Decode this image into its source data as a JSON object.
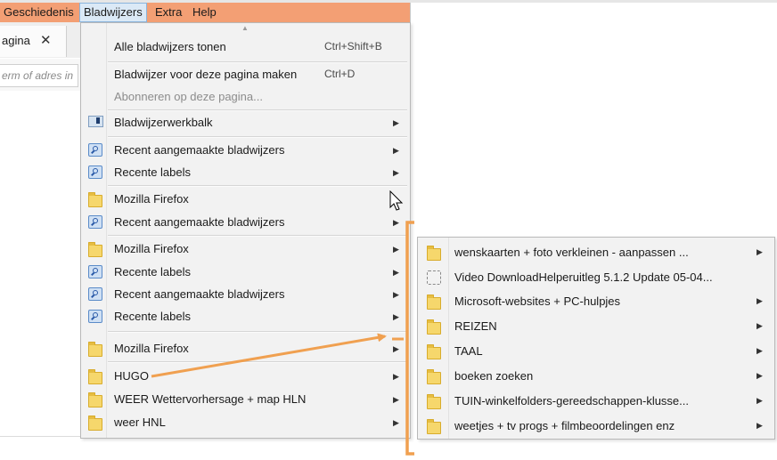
{
  "menubar": {
    "items": [
      {
        "label": "Geschiedenis",
        "active": false
      },
      {
        "label": "Bladwijzers",
        "active": true
      },
      {
        "label": "Extra",
        "active": false
      },
      {
        "label": "Help",
        "active": false
      }
    ]
  },
  "tab": {
    "label": "agina"
  },
  "urlbar": {
    "placeholder": "erm of adres in"
  },
  "bookmarks_menu": {
    "items": [
      {
        "label": "Alle bladwijzers tonen",
        "shortcut": "Ctrl+Shift+B",
        "icon": "none"
      },
      {
        "label": "Bladwijzer voor deze pagina maken",
        "shortcut": "Ctrl+D",
        "icon": "none"
      },
      {
        "label": "Abonneren op deze pagina...",
        "icon": "none",
        "disabled": true
      },
      {
        "label": "Bladwijzerwerkbalk",
        "icon": "toolbar-icon",
        "submenu": true
      },
      {
        "label": "Recent aangemaakte bladwijzers",
        "icon": "search-folder-icon",
        "submenu": true
      },
      {
        "label": "Recente labels",
        "icon": "search-folder-icon",
        "submenu": true
      },
      {
        "label": "Mozilla Firefox",
        "icon": "folder-icon",
        "submenu": false
      },
      {
        "label": "Recent aangemaakte bladwijzers",
        "icon": "search-folder-icon",
        "submenu": true
      },
      {
        "label": "Mozilla Firefox",
        "icon": "folder-icon",
        "submenu": true
      },
      {
        "label": "Recente labels",
        "icon": "search-folder-icon",
        "submenu": true
      },
      {
        "label": "Recent aangemaakte bladwijzers",
        "icon": "search-folder-icon",
        "submenu": true
      },
      {
        "label": "Recente labels",
        "icon": "search-folder-icon",
        "submenu": true
      },
      {
        "label": "Mozilla Firefox",
        "icon": "folder-icon",
        "submenu": true
      },
      {
        "label": "HUGO",
        "icon": "folder-icon",
        "submenu": true
      },
      {
        "label": "WEER Wettervorhersage + map HLN",
        "icon": "folder-icon",
        "submenu": true
      },
      {
        "label": "weer HNL",
        "icon": "folder-icon",
        "submenu": true
      }
    ]
  },
  "submenu": {
    "items": [
      {
        "label": "wenskaarten + foto verkleinen - aanpassen ...",
        "icon": "folder-icon",
        "submenu": true
      },
      {
        "label": "Video DownloadHelperuitleg  5.1.2 Update 05-04...",
        "icon": "page-icon",
        "submenu": false
      },
      {
        "label": "Microsoft-websites + PC-hulpjes",
        "icon": "folder-icon",
        "submenu": true
      },
      {
        "label": "REIZEN",
        "icon": "folder-icon",
        "submenu": true
      },
      {
        "label": "TAAL",
        "icon": "folder-icon",
        "submenu": true
      },
      {
        "label": "boeken zoeken",
        "icon": "folder-icon",
        "submenu": true
      },
      {
        "label": "TUIN-winkelfolders-gereedschappen-klusse...",
        "icon": "folder-icon",
        "submenu": true
      },
      {
        "label": "weetjes +  tv progs  + filmbeoordelingen enz",
        "icon": "folder-icon",
        "submenu": true
      }
    ]
  },
  "colors": {
    "menubar_bg": "#f39f74",
    "annotation": "#f0a050",
    "menu_bg": "#f2f2f2"
  }
}
